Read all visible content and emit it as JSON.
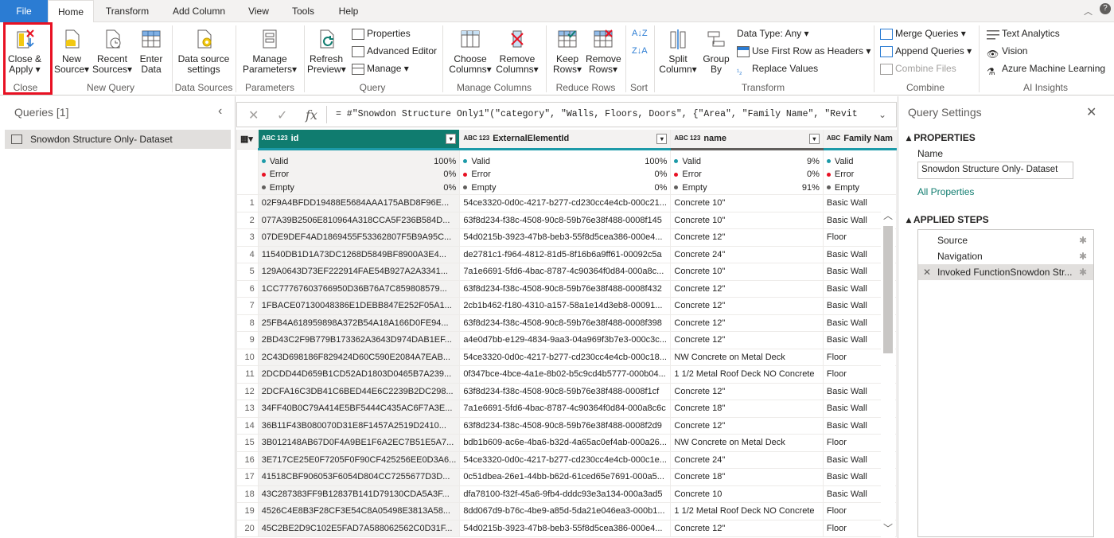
{
  "tabs": [
    "File",
    "Home",
    "Transform",
    "Add Column",
    "View",
    "Tools",
    "Help"
  ],
  "ribbon": {
    "close_apply_1": "Close &",
    "close_apply_2": "Apply",
    "new_source_1": "New",
    "new_source_2": "Source",
    "recent_sources_1": "Recent",
    "recent_sources_2": "Sources",
    "enter_data_1": "Enter",
    "enter_data_2": "Data",
    "data_source_settings_1": "Data source",
    "data_source_settings_2": "settings",
    "manage_parameters_1": "Manage",
    "manage_parameters_2": "Parameters",
    "refresh_preview_1": "Refresh",
    "refresh_preview_2": "Preview",
    "properties": "Properties",
    "advanced_editor": "Advanced Editor",
    "manage": "Manage",
    "choose_columns_1": "Choose",
    "choose_columns_2": "Columns",
    "remove_columns_1": "Remove",
    "remove_columns_2": "Columns",
    "keep_rows_1": "Keep",
    "keep_rows_2": "Rows",
    "remove_rows_1": "Remove",
    "remove_rows_2": "Rows",
    "split_column_1": "Split",
    "split_column_2": "Column",
    "group_by_1": "Group",
    "group_by_2": "By",
    "data_type": "Data Type: Any",
    "first_row_headers": "Use First Row as Headers",
    "replace_values": "Replace Values",
    "merge_queries": "Merge Queries",
    "append_queries": "Append Queries",
    "combine_files": "Combine Files",
    "text_analytics": "Text Analytics",
    "vision": "Vision",
    "azure_ml": "Azure Machine Learning",
    "groups": {
      "close": "Close",
      "new_query": "New Query",
      "data_sources": "Data Sources",
      "parameters": "Parameters",
      "query": "Query",
      "manage_columns": "Manage Columns",
      "reduce_rows": "Reduce Rows",
      "sort": "Sort",
      "transform": "Transform",
      "combine": "Combine",
      "ai_insights": "AI Insights"
    }
  },
  "queries": {
    "header": "Queries [1]",
    "items": [
      "Snowdon Structure Only- Dataset"
    ]
  },
  "formula": "= #\"Snowdon Structure Only1\"(\"category\", \"Walls, Floors, Doors\", {\"Area\", \"Family Name\", \"Revit",
  "grid": {
    "columns": [
      {
        "type": "ABC 123",
        "name": "id"
      },
      {
        "type": "ABC 123",
        "name": "ExternalElementId"
      },
      {
        "type": "ABC 123",
        "name": "name"
      },
      {
        "type": "ABC",
        "name": "Family Nam"
      }
    ],
    "profile": [
      {
        "valid": "100%",
        "error": "0%",
        "empty": "0%"
      },
      {
        "valid": "100%",
        "error": "0%",
        "empty": "0%"
      },
      {
        "valid": "9%",
        "error": "0%",
        "empty": "91%"
      },
      {
        "valid": "",
        "error": "",
        "empty": ""
      }
    ],
    "labels": {
      "valid": "Valid",
      "error": "Error",
      "empty": "Empty"
    },
    "rows": [
      [
        "1",
        "02F9A4BFDD19488E5684AAA175ABD8F96E...",
        "54ce3320-0d0c-4217-b277-cd230cc4e4cb-000c21...",
        "Concrete 10\"",
        "Basic Wall"
      ],
      [
        "2",
        "077A39B2506E810964A318CCA5F236B584D...",
        "63f8d234-f38c-4508-90c8-59b76e38f488-0008f145",
        "Concrete 10\"",
        "Basic Wall"
      ],
      [
        "3",
        "07DE9DEF4AD1869455F53362807F5B9A95C...",
        "54d0215b-3923-47b8-beb3-55f8d5cea386-000e4...",
        "Concrete 12\"",
        "Floor"
      ],
      [
        "4",
        "11540DB1D1A73DC1268D5849BF8900A3E4...",
        "de2781c1-f964-4812-81d5-8f16b6a9ff61-00092c5a",
        "Concrete 24\"",
        "Basic Wall"
      ],
      [
        "5",
        "129A0643D73EF222914FAE54B927A2A3341...",
        "7a1e6691-5fd6-4bac-8787-4c90364f0d84-000a8c...",
        "Concrete 10\"",
        "Basic Wall"
      ],
      [
        "6",
        "1CC77767603766950D36B76A7C859808579...",
        "63f8d234-f38c-4508-90c8-59b76e38f488-0008f432",
        "Concrete 12\"",
        "Basic Wall"
      ],
      [
        "7",
        "1FBACE07130048386E1DEBB847E252F05A1...",
        "2cb1b462-f180-4310-a157-58a1e14d3eb8-00091...",
        "Concrete 12\"",
        "Basic Wall"
      ],
      [
        "8",
        "25FB4A618959898A372B54A18A166D0FE94...",
        "63f8d234-f38c-4508-90c8-59b76e38f488-0008f398",
        "Concrete 12\"",
        "Basic Wall"
      ],
      [
        "9",
        "2BD43C2F9B779B173362A3643D974DAB1EF...",
        "a4e0d7bb-e129-4834-9aa3-04a969f3b7e3-000c3c...",
        "Concrete 12\"",
        "Basic Wall"
      ],
      [
        "10",
        "2C43D698186F829424D60C590E2084A7EAB...",
        "54ce3320-0d0c-4217-b277-cd230cc4e4cb-000c18...",
        "NW Concrete on Metal Deck",
        "Floor"
      ],
      [
        "11",
        "2DCDD44D659B1CD52AD1803D0465B7A239...",
        "0f347bce-4bce-4a1e-8b02-b5c9cd4b5777-000b04...",
        "1 1/2 Metal Roof Deck NO Concrete",
        "Floor"
      ],
      [
        "12",
        "2DCFA16C3DB41C6BED44E6C2239B2DC298...",
        "63f8d234-f38c-4508-90c8-59b76e38f488-0008f1cf",
        "Concrete 12\"",
        "Basic Wall"
      ],
      [
        "13",
        "34FF40B0C79A414E5BF5444C435AC6F7A3E...",
        "7a1e6691-5fd6-4bac-8787-4c90364f0d84-000a8c6c",
        "Concrete 18\"",
        "Basic Wall"
      ],
      [
        "14",
        "36B11F43B080070D31E8F1457A2519D2410...",
        "63f8d234-f38c-4508-90c8-59b76e38f488-0008f2d9",
        "Concrete 12\"",
        "Basic Wall"
      ],
      [
        "15",
        "3B012148AB67D0F4A9BE1F6A2EC7B51E5A7...",
        "bdb1b609-ac6e-4ba6-b32d-4a65ac0ef4ab-000a26...",
        "NW Concrete on Metal Deck",
        "Floor"
      ],
      [
        "16",
        "3E717CE25E0F7205F0F90CF425256EE0D3A6...",
        "54ce3320-0d0c-4217-b277-cd230cc4e4cb-000c1e...",
        "Concrete 24\"",
        "Basic Wall"
      ],
      [
        "17",
        "41518CBF906053F6054D804CC7255677D3D...",
        "0c51dbea-26e1-44bb-b62d-61ced65e7691-000a5...",
        "Concrete 18\"",
        "Basic Wall"
      ],
      [
        "18",
        "43C287383FF9B12837B141D79130CDA5A3F...",
        "dfa78100-f32f-45a6-9fb4-dddc93e3a134-000a3ad5",
        "Concrete 10",
        "Basic Wall"
      ],
      [
        "19",
        "4526C4E8B3F28CF3E54C8A05498E3813A58...",
        "8dd067d9-b76c-4be9-a85d-5da21e046ea3-000b1...",
        "1 1/2 Metal Roof Deck NO Concrete",
        "Floor"
      ],
      [
        "20",
        "45C2BE2D9C102E5FAD7A588062562C0D31F...",
        "54d0215b-3923-47b8-beb3-55f8d5cea386-000e4...",
        "Concrete 12\"",
        "Floor"
      ]
    ]
  },
  "settings": {
    "title": "Query Settings",
    "properties": "PROPERTIES",
    "name_label": "Name",
    "name_value": "Snowdon Structure Only- Dataset",
    "all_properties": "All Properties",
    "applied_steps": "APPLIED STEPS",
    "steps": [
      "Source",
      "Navigation",
      "Invoked FunctionSnowdon Str..."
    ]
  },
  "colors": {
    "accent": "#107c6f",
    "file_tab": "#2b7cd3",
    "highlight": "#e81123"
  }
}
